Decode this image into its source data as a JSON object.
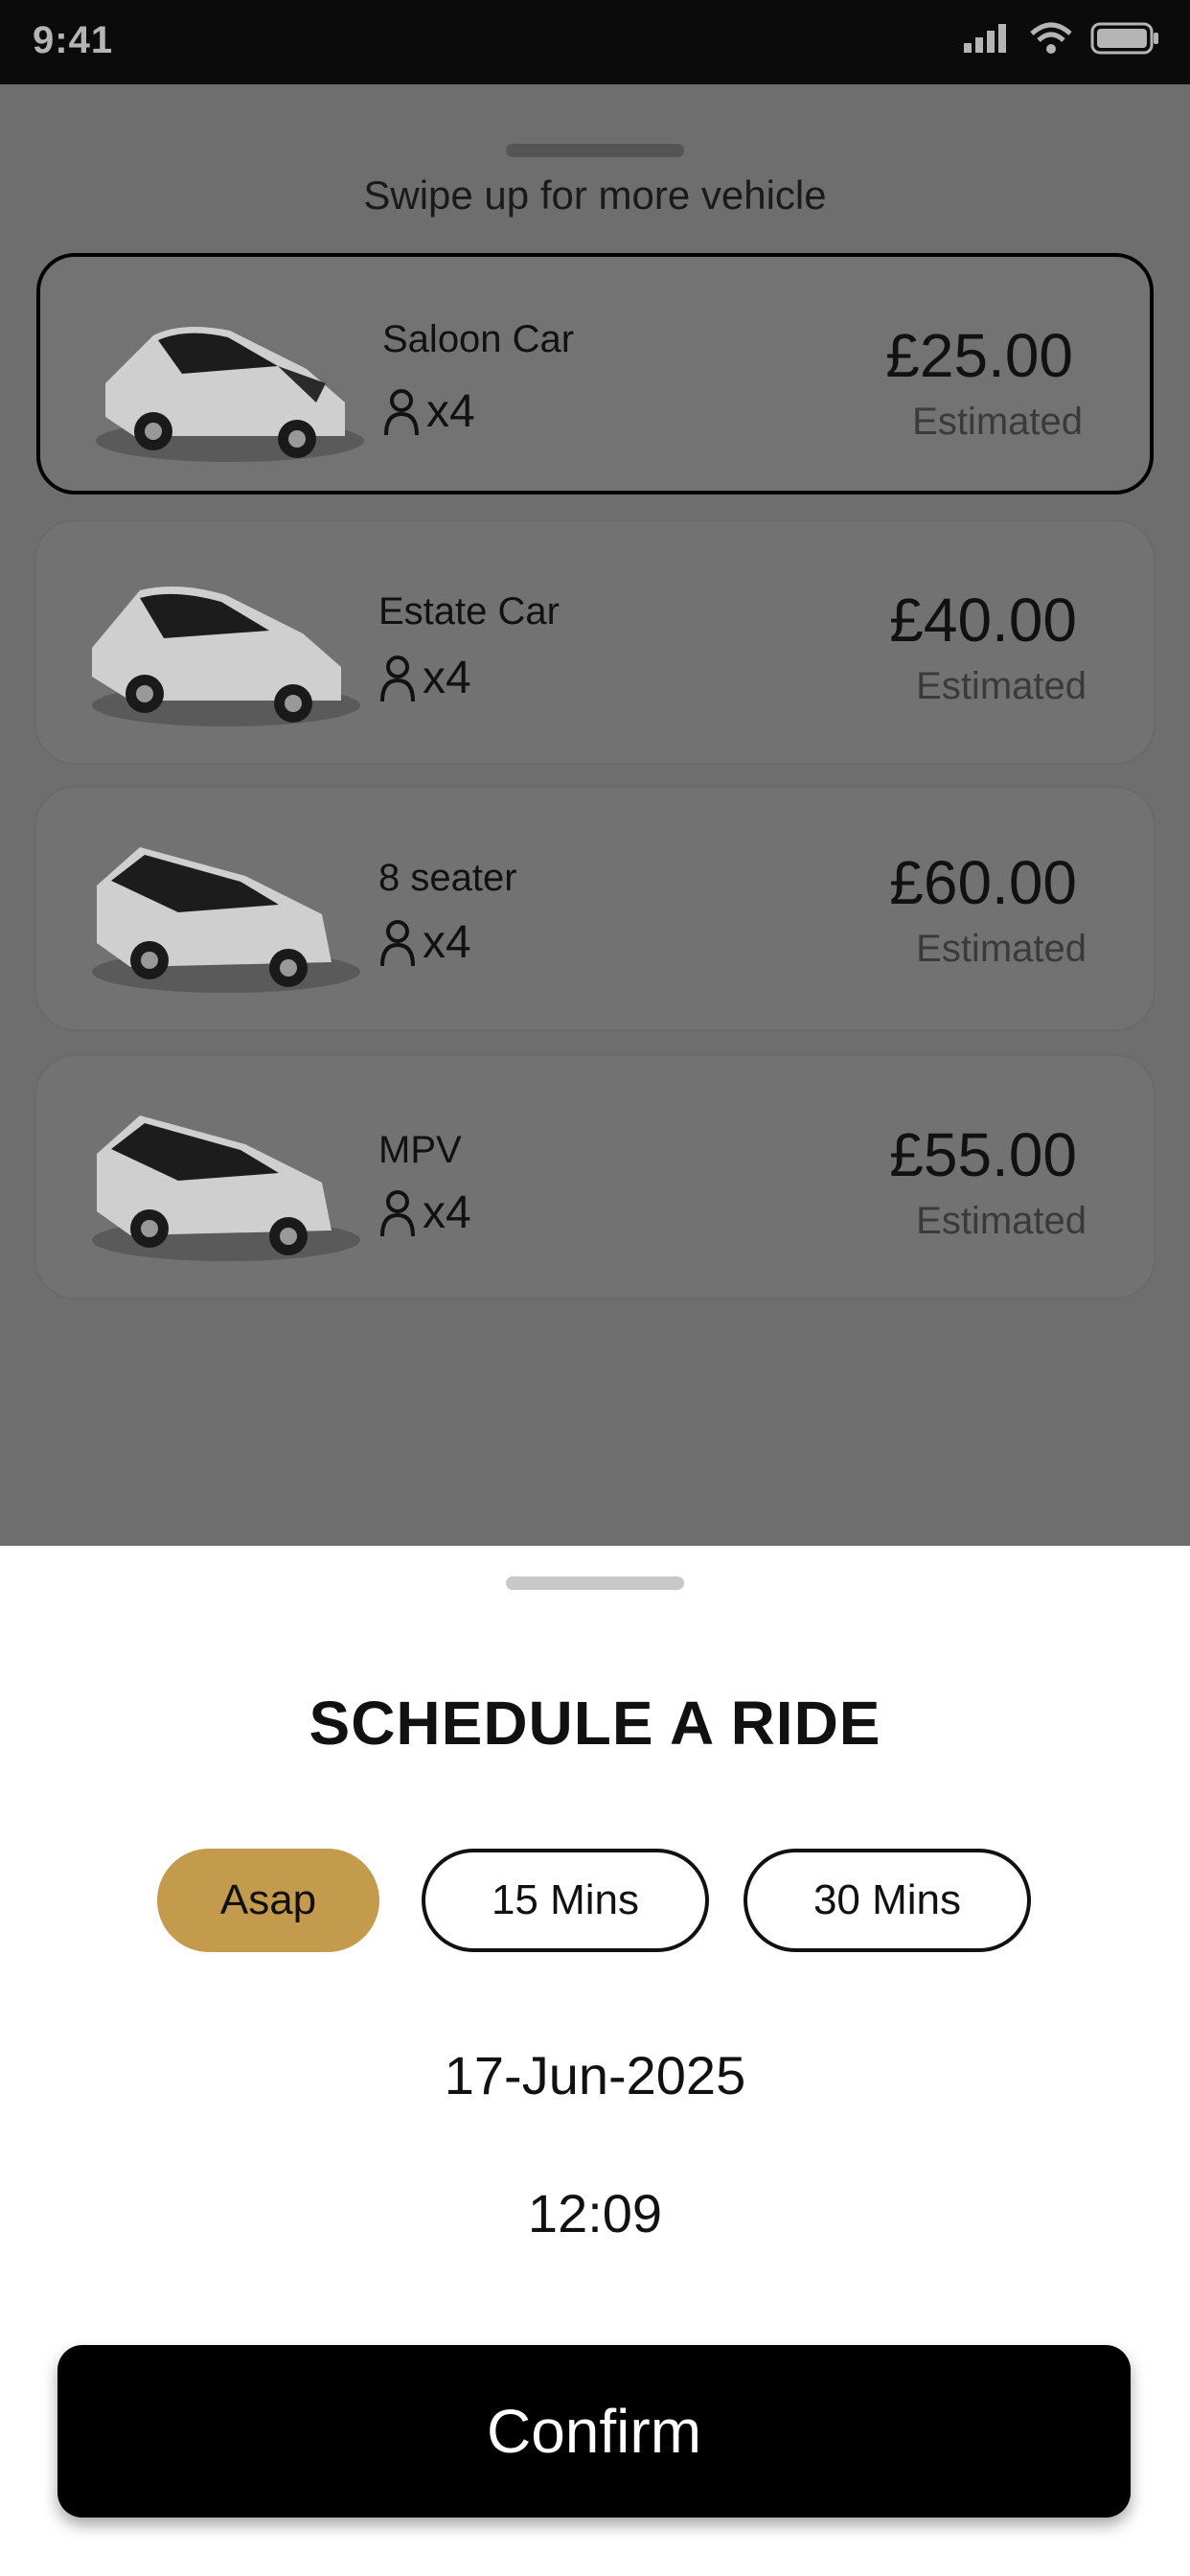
{
  "status_bar": {
    "time": "9:41"
  },
  "vehicles_panel": {
    "swipe_hint": "Swipe up for more vehicle",
    "vehicles": [
      {
        "name": "Saloon Car",
        "seats": "x4",
        "price": "£25.00",
        "estimate_label": "Estimated",
        "selected": true
      },
      {
        "name": "Estate Car",
        "seats": "x4",
        "price": "£40.00",
        "estimate_label": "Estimated",
        "selected": false
      },
      {
        "name": "8 seater",
        "seats": "x4",
        "price": "£60.00",
        "estimate_label": "Estimated",
        "selected": false
      },
      {
        "name": "MPV",
        "seats": "x4",
        "price": "£55.00",
        "estimate_label": "Estimated",
        "selected": false
      }
    ]
  },
  "schedule": {
    "title": "SCHEDULE A RIDE",
    "options": [
      {
        "label": "Asap",
        "active": true
      },
      {
        "label": "15 Mins",
        "active": false
      },
      {
        "label": "30 Mins",
        "active": false
      }
    ],
    "date": "17-Jun-2025",
    "time": "12:09",
    "confirm_label": "Confirm"
  },
  "colors": {
    "accent": "#c49a4c",
    "overlay": "#6e6e6e",
    "status_bar": "#0b0b0b"
  }
}
